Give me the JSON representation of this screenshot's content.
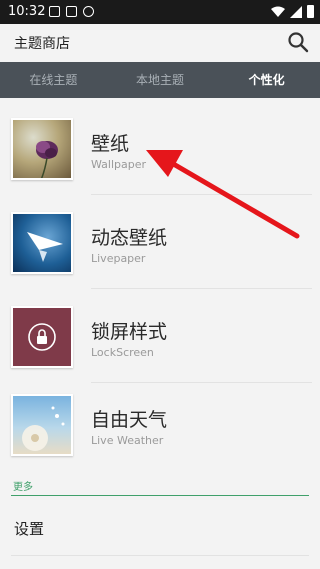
{
  "status_bar": {
    "time": "10:32"
  },
  "app_bar": {
    "title": "主题商店"
  },
  "tabs": [
    {
      "label": "在线主题",
      "active": false
    },
    {
      "label": "本地主题",
      "active": false
    },
    {
      "label": "个性化",
      "active": true
    }
  ],
  "items": [
    {
      "title": "壁纸",
      "subtitle": "Wallpaper"
    },
    {
      "title": "动态壁纸",
      "subtitle": "Livepaper"
    },
    {
      "title": "锁屏样式",
      "subtitle": "LockScreen"
    },
    {
      "title": "自由天气",
      "subtitle": "Live Weather"
    }
  ],
  "more": {
    "label": "更多"
  },
  "settings": {
    "label": "设置"
  },
  "colors": {
    "status_bar": "#1a1a1a",
    "tab_bar": "#4a5158",
    "accent_green": "#3fa06a",
    "annotation_red": "#e5161b"
  }
}
